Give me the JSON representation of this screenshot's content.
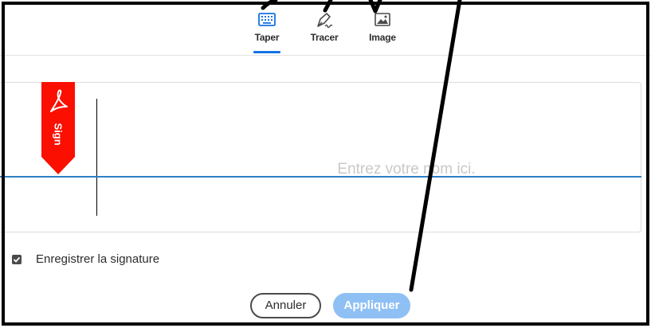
{
  "tabs": [
    {
      "label": "Taper",
      "icon": "keyboard-icon",
      "active": true
    },
    {
      "label": "Tracer",
      "icon": "pen-draw-icon",
      "active": false
    },
    {
      "label": "Image",
      "icon": "image-icon",
      "active": false
    }
  ],
  "signature": {
    "placeholder": "Entrez votre nom ici.",
    "value": "",
    "badge_label": "Sign"
  },
  "save_option": {
    "label": "Enregistrer la signature",
    "checked": true
  },
  "buttons": {
    "cancel_label": "Annuler",
    "apply_label": "Appliquer"
  },
  "colors": {
    "accent": "#1473e6",
    "baseline": "#2d80c6",
    "badge": "#fa0f00",
    "apply_disabled": "#8fc0f4"
  }
}
